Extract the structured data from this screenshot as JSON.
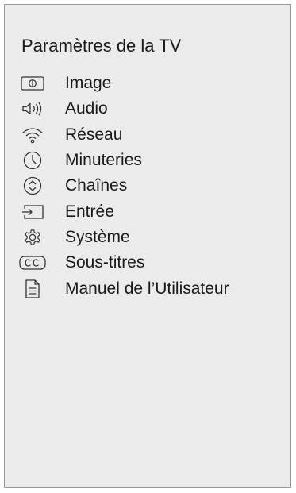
{
  "header": {
    "title": "Paramètres de la TV"
  },
  "menu": {
    "items": [
      {
        "label": "Image",
        "icon": "picture-icon"
      },
      {
        "label": "Audio",
        "icon": "speaker-icon"
      },
      {
        "label": "Réseau",
        "icon": "wifi-icon"
      },
      {
        "label": "Minuteries",
        "icon": "clock-icon"
      },
      {
        "label": "Chaînes",
        "icon": "channel-up-down-icon"
      },
      {
        "label": "Entrée",
        "icon": "input-icon"
      },
      {
        "label": "Système",
        "icon": "gear-icon"
      },
      {
        "label": "Sous-titres",
        "icon": "cc-icon"
      },
      {
        "label": "Manuel de l’Utilisateur",
        "icon": "document-icon"
      }
    ]
  },
  "colors": {
    "panel_background": "#ebebeb",
    "panel_border": "#9a9a9a",
    "text": "#1a1a1a"
  }
}
